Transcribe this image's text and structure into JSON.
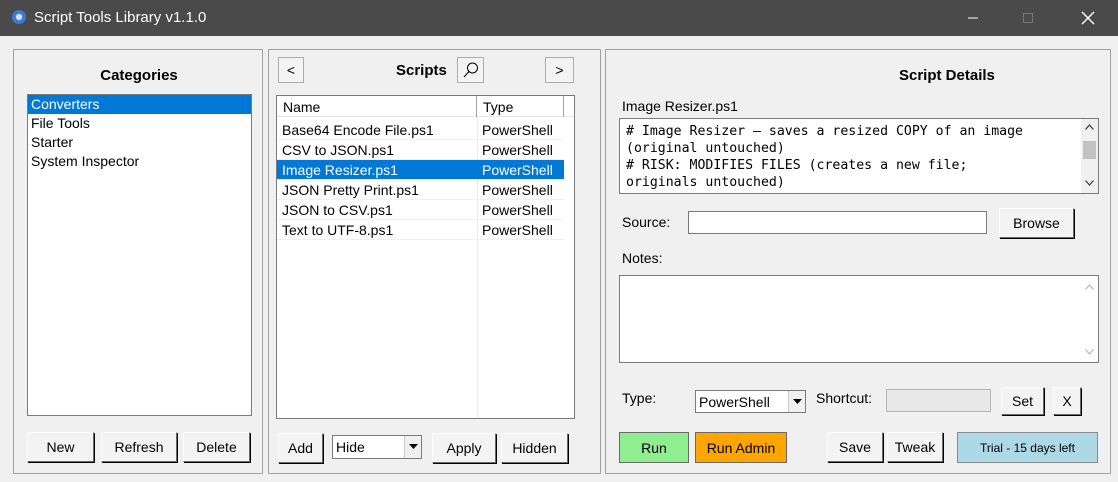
{
  "window": {
    "title": "Script Tools Library v1.1.0",
    "icon": "powershell-app-icon"
  },
  "categories": {
    "heading": "Categories",
    "items": [
      "Converters",
      "File Tools",
      "Starter",
      "System Inspector"
    ],
    "selected_index": 0,
    "buttons": {
      "new": "New",
      "refresh": "Refresh",
      "delete": "Delete"
    }
  },
  "scripts": {
    "heading": "Scripts",
    "prev_label": "<",
    "next_label": ">",
    "columns": [
      "Name",
      "Type"
    ],
    "rows": [
      {
        "name": "Base64 Encode File.ps1",
        "type": "PowerShell"
      },
      {
        "name": "CSV to JSON.ps1",
        "type": "PowerShell"
      },
      {
        "name": "Image Resizer.ps1",
        "type": "PowerShell"
      },
      {
        "name": "JSON Pretty Print.ps1",
        "type": "PowerShell"
      },
      {
        "name": "JSON to CSV.ps1",
        "type": "PowerShell"
      },
      {
        "name": "Text to UTF-8.ps1",
        "type": "PowerShell"
      }
    ],
    "selected_index": 2,
    "buttons": {
      "add": "Add",
      "apply": "Apply",
      "hidden": "Hidden"
    },
    "visibility_combo": "Hide"
  },
  "details": {
    "heading": "Script Details",
    "script_name": "Image Resizer.ps1",
    "script_text_lines": [
      "# Image Resizer — saves a resized COPY of an image",
      "(original untouched)",
      "# RISK: MODIFIES FILES (creates a new file;",
      "originals untouched)"
    ],
    "source_label": "Source:",
    "source_value": "",
    "browse_label": "Browse",
    "notes_label": "Notes:",
    "notes_value": "",
    "type_label": "Type:",
    "type_value": "PowerShell",
    "shortcut_label": "Shortcut:",
    "shortcut_value": "",
    "set_label": "Set",
    "clear_label": "X",
    "run_label": "Run",
    "run_admin_label": "Run Admin",
    "save_label": "Save",
    "tweak_label": "Tweak",
    "trial_label": "Trial - 15 days left"
  },
  "colors": {
    "titlebar": "#4a4a4a",
    "selection": "#0078d7",
    "run_button": "#90ee90",
    "run_admin_button": "#ffa500",
    "trial_badge": "#add8e6"
  }
}
